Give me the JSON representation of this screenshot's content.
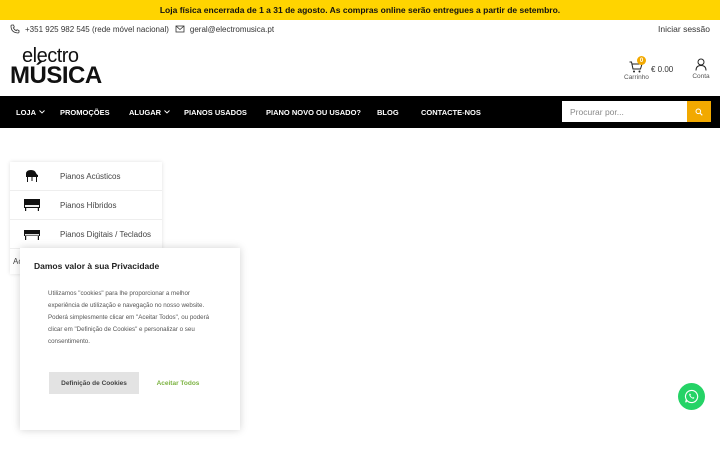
{
  "announcement": "Loja física encerrada de 1 a 31 de agosto. As compras online serão entregues a partir de setembro.",
  "topbar": {
    "phone": "+351 925 982 545 (rede móvel nacional)",
    "email": "geral@electromusica.pt",
    "login": "Iniciar sessão"
  },
  "logo": {
    "line1": "electro",
    "line2": "MÚSICA"
  },
  "cart": {
    "count": "0",
    "label": "Carrinho",
    "total": "€ 0.00"
  },
  "account": {
    "label": "Conta"
  },
  "nav": {
    "items": [
      {
        "label": "LOJA",
        "has_dropdown": true
      },
      {
        "label": "PROMOÇÕES",
        "has_dropdown": false
      },
      {
        "label": "ALUGAR",
        "has_dropdown": true
      },
      {
        "label": "PIANOS USADOS",
        "has_dropdown": false
      },
      {
        "label": "PIANO NOVO OU USADO?",
        "has_dropdown": false
      },
      {
        "label": "BLOG",
        "has_dropdown": false
      },
      {
        "label": "CONTACTE-NOS",
        "has_dropdown": false
      }
    ]
  },
  "search": {
    "placeholder": "Procurar por..."
  },
  "categories": {
    "items": [
      {
        "label": "Pianos Acústicos",
        "icon": "grand-piano-icon"
      },
      {
        "label": "Pianos Híbridos",
        "icon": "upright-piano-icon"
      },
      {
        "label": "Pianos Digitais / Teclados",
        "icon": "digital-piano-icon"
      }
    ],
    "extra": "Ac"
  },
  "cookie": {
    "title": "Damos valor à sua Privacidade",
    "text": "Utilizamos \"cookies\" para lhe proporcionar a melhor experiência de utilização e navegação no nosso website. Poderá simplesmente clicar em \"Aceitar Todos\", ou poderá clicar em \"Definição de Cookies\" e personalizar o seu consentimento.",
    "settings_label": "Definição de Cookies",
    "accept_label": "Aceitar Todos"
  },
  "colors": {
    "announcement_bg": "#ffd400",
    "nav_bg": "#000000",
    "accent": "#f2a900",
    "accept_green": "#7cb342",
    "whatsapp": "#25d366"
  }
}
